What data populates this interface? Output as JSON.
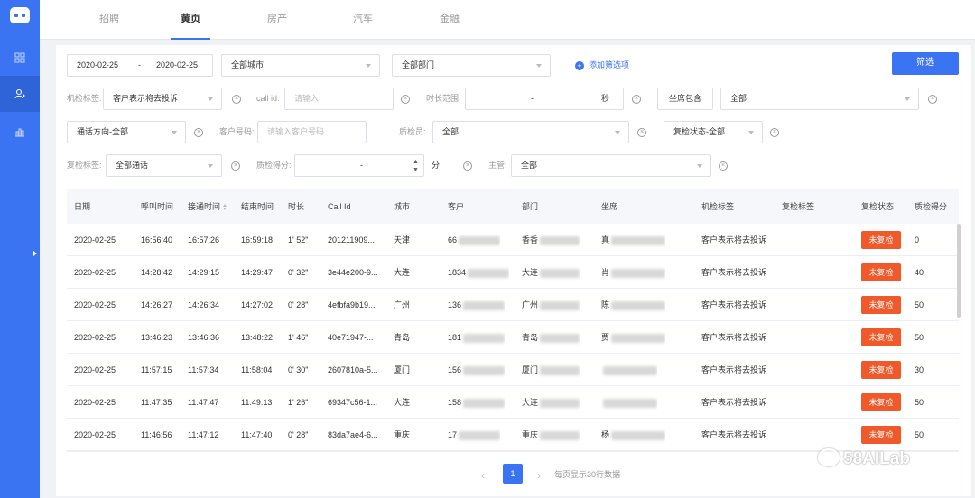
{
  "tabs": [
    "招聘",
    "黄页",
    "房产",
    "汽车",
    "金融"
  ],
  "active_tab": 1,
  "filters": {
    "date_start": "2020-02-25",
    "date_sep": "-",
    "date_end": "2020-02-25",
    "city": "全部城市",
    "department": "全部部门",
    "add_filter": "添加筛选项",
    "submit": "筛选",
    "machine_tag_label": "机检标签:",
    "machine_tag_value": "客户表示将去投诉",
    "callid_label": "call id:",
    "callid_placeholder": "请输入",
    "duration_label": "时长范围:",
    "duration_sep": "-",
    "duration_unit": "秒",
    "agent_contains": "坐席包含",
    "agent_value": "全部",
    "direction_value": "通话方向-全部",
    "customer_phone_label": "客户号码:",
    "customer_phone_placeholder": "请输入客户号码",
    "inspector_label": "质检员:",
    "inspector_value": "全部",
    "recheck_status_value": "复检状态-全部",
    "recheck_tag_label": "复检标签:",
    "recheck_tag_value": "全部通话",
    "score_label": "质检得分:",
    "score_sep": "-",
    "score_unit": "分",
    "supervisor_label": "主管:",
    "supervisor_value": "全部"
  },
  "table": {
    "headers": [
      "日期",
      "呼叫时间",
      "接通时间",
      "结束时间",
      "时长",
      "Call Id",
      "城市",
      "客户",
      "部门",
      "坐席",
      "机检标签",
      "复检标签",
      "复检状态",
      "质检得分"
    ],
    "rows": [
      {
        "date": "2020-02-25",
        "call": "16:56:40",
        "connect": "16:57:26",
        "end": "16:59:18",
        "dur": "1' 52\"",
        "callid": "201211909...",
        "city": "天津",
        "cust": "66",
        "dept": "香香",
        "agent": "真",
        "tag": "客户表示将去投诉",
        "status": "未复检",
        "score": "0"
      },
      {
        "date": "2020-02-25",
        "call": "14:28:42",
        "connect": "14:29:15",
        "end": "14:29:47",
        "dur": "0' 32\"",
        "callid": "3e44e200-9...",
        "city": "大连",
        "cust": "1834",
        "dept": "大连",
        "agent": "肖",
        "tag": "客户表示将去投诉",
        "status": "未复检",
        "score": "40"
      },
      {
        "date": "2020-02-25",
        "call": "14:26:27",
        "connect": "14:26:34",
        "end": "14:27:02",
        "dur": "0' 28\"",
        "callid": "4efbfa9b19...",
        "city": "广州",
        "cust": "136",
        "dept": "广州",
        "agent": "陈",
        "tag": "客户表示将去投诉",
        "status": "未复检",
        "score": "50"
      },
      {
        "date": "2020-02-25",
        "call": "13:46:23",
        "connect": "13:46:36",
        "end": "13:48:22",
        "dur": "1' 46\"",
        "callid": "40e71947-...",
        "city": "青岛",
        "cust": "181",
        "dept": "青岛",
        "agent": "贾",
        "tag": "客户表示将去投诉",
        "status": "未复检",
        "score": "50"
      },
      {
        "date": "2020-02-25",
        "call": "11:57:15",
        "connect": "11:57:34",
        "end": "11:58:04",
        "dur": "0' 30\"",
        "callid": "2607810a-5...",
        "city": "厦门",
        "cust": "156",
        "dept": "厦门",
        "agent": "",
        "tag": "客户表示将去投诉",
        "status": "未复检",
        "score": "30"
      },
      {
        "date": "2020-02-25",
        "call": "11:47:35",
        "connect": "11:47:47",
        "end": "11:49:13",
        "dur": "1' 26\"",
        "callid": "69347c56-1...",
        "city": "大连",
        "cust": "158",
        "dept": "大连",
        "agent": "",
        "tag": "客户表示将去投诉",
        "status": "未复检",
        "score": "50"
      },
      {
        "date": "2020-02-25",
        "call": "11:46:56",
        "connect": "11:47:12",
        "end": "11:47:40",
        "dur": "0' 28\"",
        "callid": "83da7ae4-6...",
        "city": "重庆",
        "cust": "17",
        "dept": "重庆",
        "agent": "杨",
        "tag": "客户表示将去投诉",
        "status": "未复检",
        "score": "50"
      }
    ]
  },
  "pagination": {
    "current_page": "1",
    "info": "每页显示30行数据",
    "prev": "‹",
    "next": "›"
  },
  "watermark": "58AILab",
  "colors": {
    "primary": "#3b74f2",
    "badge": "#f05a2b"
  }
}
